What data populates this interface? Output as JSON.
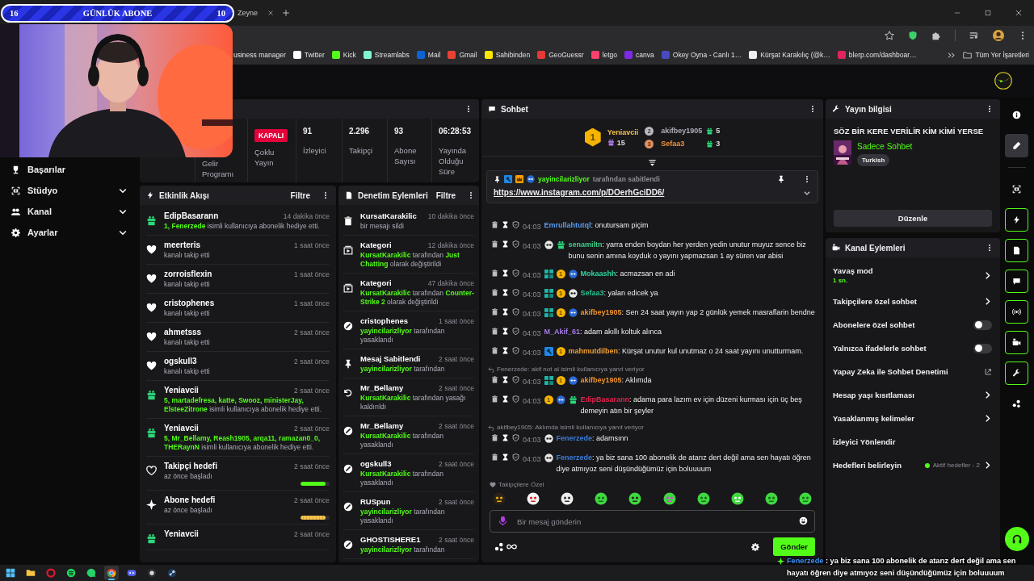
{
  "stream_overlay": {
    "goal": {
      "current": "16",
      "title": "GÜNLÜK ABONE",
      "target": "10"
    },
    "chat": {
      "user": "Fenerzede",
      "text": " : ya biz sana 100 abonelik de atarız dert değil ama sen hayatı öğren diye atmıyoz seni düşündüğümüz için boluuuum"
    }
  },
  "browser": {
    "tab": {
      "label": "Zeyne"
    },
    "bookmarks": [
      "usiness manager",
      "Twitter",
      "Kick",
      "Streamlabs",
      "Mail",
      "Gmail",
      "Sahibinden",
      "GeoGuessr",
      "letgo",
      "canva",
      "Okey Oyna - Canlı 1…",
      "Kürşat Karakılıç (@k…",
      "blerp.com/dashboar…"
    ],
    "all_bookmarks": "Tüm Yer İşaretleri"
  },
  "sidebar": {
    "items": [
      {
        "label": "Başarılar",
        "kind": "link"
      },
      {
        "label": "Stüdyo",
        "kind": "group",
        "expanded": false
      },
      {
        "label": "Kanal",
        "kind": "group",
        "expanded": false
      },
      {
        "label": "Ayarlar",
        "kind": "group",
        "expanded": false
      }
    ]
  },
  "stats": {
    "cells": [
      {
        "kind": "label",
        "label": "Gelir Programı"
      },
      {
        "kind": "badge",
        "badge": "KAPALI",
        "label": "Çoklu Yayın"
      },
      {
        "kind": "value",
        "value": "91",
        "label": "İzleyici"
      },
      {
        "kind": "value",
        "value": "2.296",
        "label": "Takipçi"
      },
      {
        "kind": "value",
        "value": "93",
        "label": "Abone Sayısı"
      },
      {
        "kind": "value",
        "value": "06:28:53",
        "label": "Yayında Olduğu Süre"
      }
    ]
  },
  "activity": {
    "title": "Etkinlik Akışı",
    "filter": "Filtre",
    "items": [
      {
        "kind": "gift",
        "user": "EdipBasarann",
        "time": "14 dakika önce",
        "text": "**1, Fenerzede** isimli kullanıcıya abonelik hediye etti."
      },
      {
        "kind": "follow",
        "user": "meerteris",
        "time": "1 saat önce",
        "text": "kanalı takip etti"
      },
      {
        "kind": "follow",
        "user": "zorroisflexin",
        "time": "1 saat önce",
        "text": "kanalı takip etti"
      },
      {
        "kind": "follow",
        "user": "cristophenes",
        "time": "1 saat önce",
        "text": "kanalı takip etti"
      },
      {
        "kind": "follow",
        "user": "ahmetsss",
        "time": "2 saat önce",
        "text": "kanalı takip etti"
      },
      {
        "kind": "follow",
        "user": "ogskull3",
        "time": "2 saat önce",
        "text": "kanalı takip etti"
      },
      {
        "kind": "gift",
        "user": "Yeniavcii",
        "time": "2 saat önce",
        "text": "**5, martadefresa, katte, Swooz, ministerJay, ElsteeZitrone** isimli kullanıcıya abonelik hediye etti."
      },
      {
        "kind": "gift",
        "user": "Yeniavcii",
        "time": "2 saat önce",
        "text": "**5, Mr_Bellamy, Reash1905, arqa11, ramazan0_0, THERaynN** isimli kullanıcıya abonelik hediye etti."
      },
      {
        "kind": "follow_goal",
        "user": "Takipçi hedefi",
        "time": "2 saat önce",
        "text": "az önce başladı",
        "level": 0.85
      },
      {
        "kind": "sub_goal",
        "user": "Abone hedefi",
        "time": "2 saat önce",
        "text": "az önce başladı",
        "level": 0.85
      },
      {
        "kind": "gift",
        "user": "Yeniavcii",
        "time": "2 saat önce"
      }
    ]
  },
  "moderation": {
    "title": "Denetim Eylemleri",
    "filter": "Filtre",
    "items": [
      {
        "kind": "delete",
        "title": "KursatKarakilic",
        "time": "10 dakika önce",
        "text": "bir mesajı sildi"
      },
      {
        "kind": "category",
        "title": "Kategori",
        "time": "12 dakika önce",
        "text": "**KursatKarakilic** tarafından **Just Chatting** olarak değiştirildi"
      },
      {
        "kind": "category",
        "title": "Kategori",
        "time": "47 dakika önce",
        "text": "**KursatKarakilic** tarafından **Counter-Strike 2** olarak değiştirildi"
      },
      {
        "kind": "ban",
        "title": "cristophenes",
        "time": "1 saat önce",
        "text": "**yayincilarizliyor** tarafından yasaklandı"
      },
      {
        "kind": "pin",
        "title": "Mesaj Sabitlendi",
        "time": "2 saat önce",
        "text": "**yayincilarizliyor** tarafından"
      },
      {
        "kind": "unban",
        "title": "Mr_Bellamy",
        "time": "2 saat önce",
        "text": "**KursatKarakilic** tarafından yasağı kaldırıldı"
      },
      {
        "kind": "ban",
        "title": "Mr_Bellamy",
        "time": "2 saat önce",
        "text": "**KursatKarakilic** tarafından yasaklandı"
      },
      {
        "kind": "ban",
        "title": "ogskull3",
        "time": "2 saat önce",
        "text": "**KursatKarakilic** tarafından yasaklandı"
      },
      {
        "kind": "ban",
        "title": "RUSpun",
        "time": "2 saat önce",
        "text": "**yayincilarizliyor** tarafından yasaklandı"
      },
      {
        "kind": "ban",
        "title": "GHOSTISHERE1",
        "time": "2 saat önce",
        "text": "**yayincilarizliyor** tarafından"
      }
    ]
  },
  "chat": {
    "title": "Sohbet",
    "leaders": [
      {
        "rank": "1",
        "user": "Yeniavcii",
        "count": "15"
      },
      {
        "rank": "2",
        "user": "akifbey1905",
        "count": "5"
      },
      {
        "rank": "3",
        "user": "Sefaa3",
        "count": "3"
      }
    ],
    "pinned": {
      "user": "yayincilarizliyor",
      "note": "tarafından sabitlendi",
      "link": "https://www.instagram.com/p/DOerhGciDD6/"
    },
    "messages": [
      {
        "time": "04:03",
        "user": "Emrullahtutql",
        "color": "#5b9bea",
        "text": ": onutursam piçim"
      },
      {
        "time": "04:03",
        "user": "senamiltn",
        "color": "#3fcf8a",
        "badges": [
          {
            "kind": "panda"
          },
          {
            "kind": "gift"
          }
        ],
        "text": ": yarra enden boydan her yerden yedin unutur muyuz sence biz bunu senin amına koyduk o yayını yapmazsan 1 ay süren var abisi"
      },
      {
        "time": "04:03",
        "user": "Mokaashh",
        "color": "#2ed3a0",
        "badges": [
          {
            "kind": "sub"
          },
          {
            "kind": "rank",
            "label": "1"
          },
          {
            "kind": "mask"
          }
        ],
        "text": ": acmazsan en adi"
      },
      {
        "time": "04:03",
        "user": "Sefaa3",
        "color": "#27c28d",
        "badges": [
          {
            "kind": "sub"
          },
          {
            "kind": "rank",
            "label": "1"
          },
          {
            "kind": "panda"
          }
        ],
        "text": ": yalan edicek ya"
      },
      {
        "time": "04:03",
        "user": "akifbey1905",
        "color": "#f0932b",
        "badges": [
          {
            "kind": "sub"
          },
          {
            "kind": "rank",
            "label": "1"
          },
          {
            "kind": "mask"
          }
        ],
        "text": ": Sen 24 saat yayın yap 2 günlük yemek masraflarin bendne"
      },
      {
        "time": "04:03",
        "user": "M_Akif_61",
        "color": "#a57be6",
        "text": ": adam akıllı koltuk alınca"
      },
      {
        "time": "04:03",
        "user": "mahmutdilben",
        "color": "#f0a030",
        "badges": [
          {
            "kind": "mod"
          },
          {
            "kind": "rank",
            "label": "1"
          }
        ],
        "text": ": Kürşat unutur kul unutmaz o 24 saat yayını unutturmam."
      },
      {
        "reply": "Fenerzede: akif not al isimli kullanıcıya yanıt veriyor",
        "time": "04:03",
        "user": "akifbey1905",
        "color": "#f0932b",
        "badges": [
          {
            "kind": "sub"
          },
          {
            "kind": "rank",
            "label": "1"
          },
          {
            "kind": "mask"
          }
        ],
        "text": ": Aklımda"
      },
      {
        "time": "04:03",
        "user": "EdipBasarann",
        "color": "#e3204c",
        "badges": [
          {
            "kind": "rank",
            "label": "1"
          },
          {
            "kind": "mask"
          },
          {
            "kind": "gift"
          }
        ],
        "text": ": adama para lazım ev için düzeni kurması için üç beş demeyin atın bir şeyler"
      },
      {
        "reply": "akifbey1905: Aklımda isimli kullanıcıya yanıt veriyor",
        "time": "04:03",
        "user": "Fenerzede",
        "color": "#3a7bd5",
        "badges": [
          {
            "kind": "panda"
          }
        ],
        "text": ": adamsınn"
      },
      {
        "time": "04:03",
        "user": "Fenerzede",
        "color": "#3a7bd5",
        "badges": [
          {
            "kind": "panda"
          }
        ],
        "text": ": ya biz sana 100 abonelik de atarız dert değil ama sen hayatı öğren diye atmıyoz seni düşündüğümüz için boluuuum"
      }
    ],
    "followers_only": "Takipçilere Özel",
    "placeholder": "Bir mesaj gönderin",
    "send": "Gönder"
  },
  "info": {
    "title": "Yayın bilgisi",
    "stream_title": "SÖZ BİR KERE VERİLİR KİM KİMİ YERSE",
    "category": "Sadece Sohbet",
    "tag": "Turkish",
    "edit": "Düzenle"
  },
  "actions": {
    "title": "Kanal Eylemleri",
    "items": [
      {
        "kind": "chevron",
        "label": "Yavaş mod",
        "value": "1 sn."
      },
      {
        "kind": "chevron",
        "label": "Takipçilere özel sohbet"
      },
      {
        "kind": "toggle",
        "label": "Abonelere özel sohbet",
        "on": false
      },
      {
        "kind": "toggle",
        "label": "Yalnızca ifadelerle sohbet",
        "on": false
      },
      {
        "kind": "external",
        "label": "Yapay Zeka ile Sohbet Denetimi"
      },
      {
        "kind": "chevron",
        "label": "Hesap yaşı kısıtlaması"
      },
      {
        "kind": "chevron",
        "label": "Yasaklanmış kelimeler"
      },
      {
        "kind": "plain",
        "label": "İzleyici Yönlendir"
      },
      {
        "kind": "status",
        "label": "Hedefleri belirleyin",
        "status": "Aktif hedefler - 2"
      }
    ]
  },
  "rail": {
    "items": [
      {
        "kind": "info",
        "selected": false,
        "active": false
      },
      {
        "kind": "edit",
        "selected": true,
        "active": false
      },
      {
        "kind": "divider"
      },
      {
        "kind": "camera",
        "selected": false,
        "active": false
      },
      {
        "kind": "bolt",
        "selected": false,
        "active": true
      },
      {
        "kind": "doc",
        "selected": false,
        "active": true
      },
      {
        "kind": "chat",
        "selected": false,
        "active": true
      },
      {
        "kind": "broadcast",
        "selected": false,
        "active": true
      },
      {
        "kind": "videocam",
        "selected": false,
        "active": true
      },
      {
        "kind": "wrench",
        "selected": false,
        "active": true
      },
      {
        "kind": "dots",
        "selected": false,
        "active": false
      }
    ]
  },
  "taskbar": {
    "items": [
      {
        "kind": "windows",
        "selected": false
      },
      {
        "kind": "folder",
        "selected": false
      },
      {
        "kind": "opera",
        "selected": false
      },
      {
        "kind": "spotify",
        "selected": false
      },
      {
        "kind": "whatsapp",
        "selected": false
      },
      {
        "kind": "chrome",
        "selected": true
      },
      {
        "kind": "discord",
        "selected": false
      },
      {
        "kind": "obs",
        "selected": false
      },
      {
        "kind": "steam",
        "selected": false
      }
    ]
  }
}
